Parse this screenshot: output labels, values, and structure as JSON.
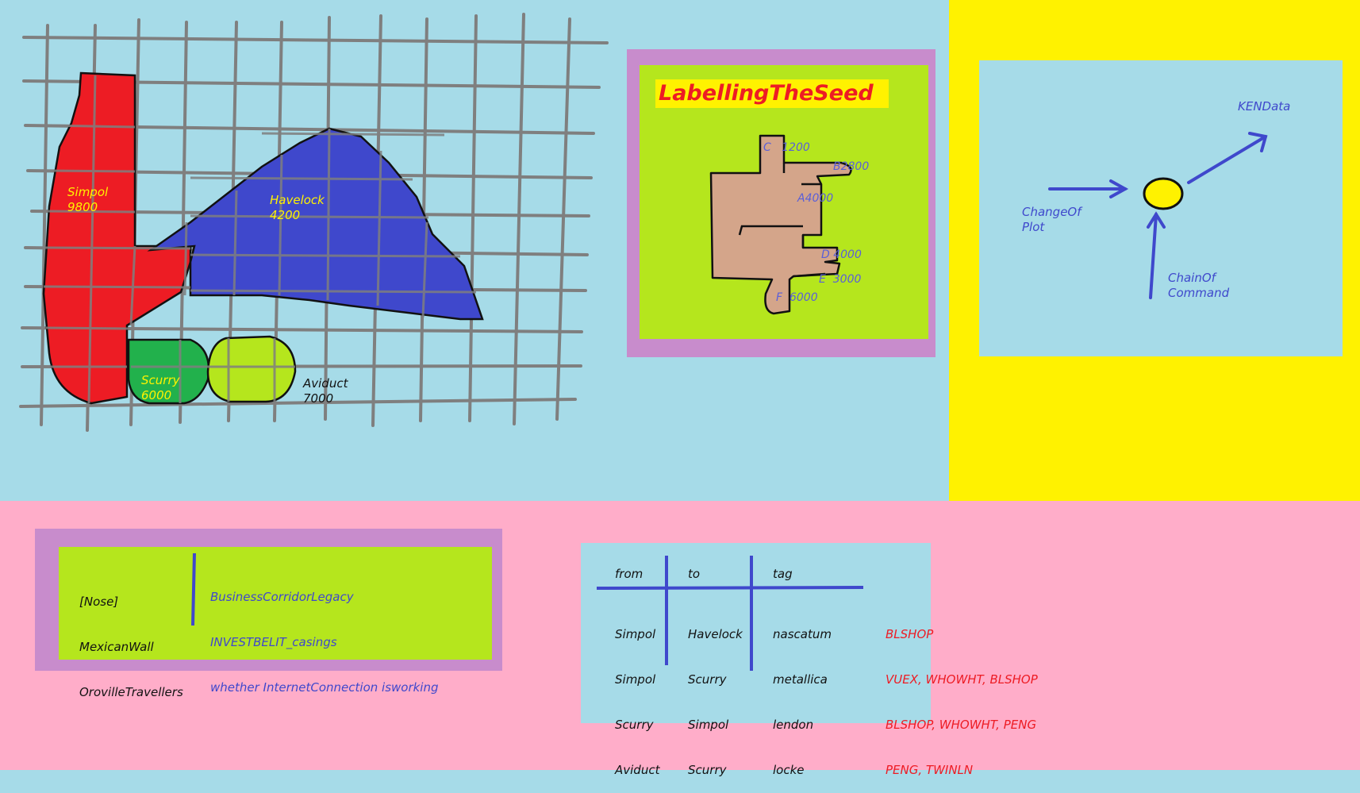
{
  "regions": [
    {
      "name": "Simpol",
      "value": "9800"
    },
    {
      "name": "Havelock",
      "value": "4200"
    },
    {
      "name": "Scurry",
      "value": "6000"
    },
    {
      "name": "Aviduct",
      "value": "7000"
    }
  ],
  "seed": {
    "title": "LabellingTheSeed",
    "fingers": [
      {
        "letter": "C",
        "value": "1200"
      },
      {
        "letter": "B",
        "value": "2800"
      },
      {
        "letter": "A",
        "value": "4000"
      },
      {
        "letter": "D",
        "value": "4000"
      },
      {
        "letter": "E",
        "value": "3000"
      },
      {
        "letter": "F",
        "value": "6000"
      }
    ]
  },
  "ken": {
    "output": "KENData",
    "input_left": "ChangeOf\nPlot",
    "input_bottom": "ChainOf\nCommand"
  },
  "notes": {
    "left": [
      "[Nose]",
      "MexicanWall",
      "OrovilleTravellers"
    ],
    "right": [
      "BusinessCorridorLegacy",
      "INVESTBELIT_casings",
      "whether InternetConnection isworking"
    ]
  },
  "table": {
    "headers": [
      "from",
      "to",
      "tag"
    ],
    "rows": [
      {
        "from": "Simpol",
        "to": "Havelock",
        "tag": "nascatum",
        "extra": "BLSHOP"
      },
      {
        "from": "Simpol",
        "to": "Scurry",
        "tag": "metallica",
        "extra": "VUEX, WHOWHT, BLSHOP"
      },
      {
        "from": "Scurry",
        "to": "Simpol",
        "tag": "lendon",
        "extra": "BLSHOP, WHOWHT, PENG"
      },
      {
        "from": "Aviduct",
        "to": "Scurry",
        "tag": "locke",
        "extra": "PENG, TWINLN"
      }
    ]
  },
  "colors": {
    "sky": "#a6dbe8",
    "yellow": "#fff200",
    "pink": "#ffadc9",
    "lime": "#b5e61d",
    "purple": "#c88ccc",
    "red": "#ed1c24",
    "blue": "#3f48cc",
    "green": "#22b14c",
    "tan": "#d4a58a",
    "grid": "#7f7f7f"
  },
  "icons": {
    "ken_node": "yellow-circle-node",
    "arrows": "arrow-icon"
  }
}
